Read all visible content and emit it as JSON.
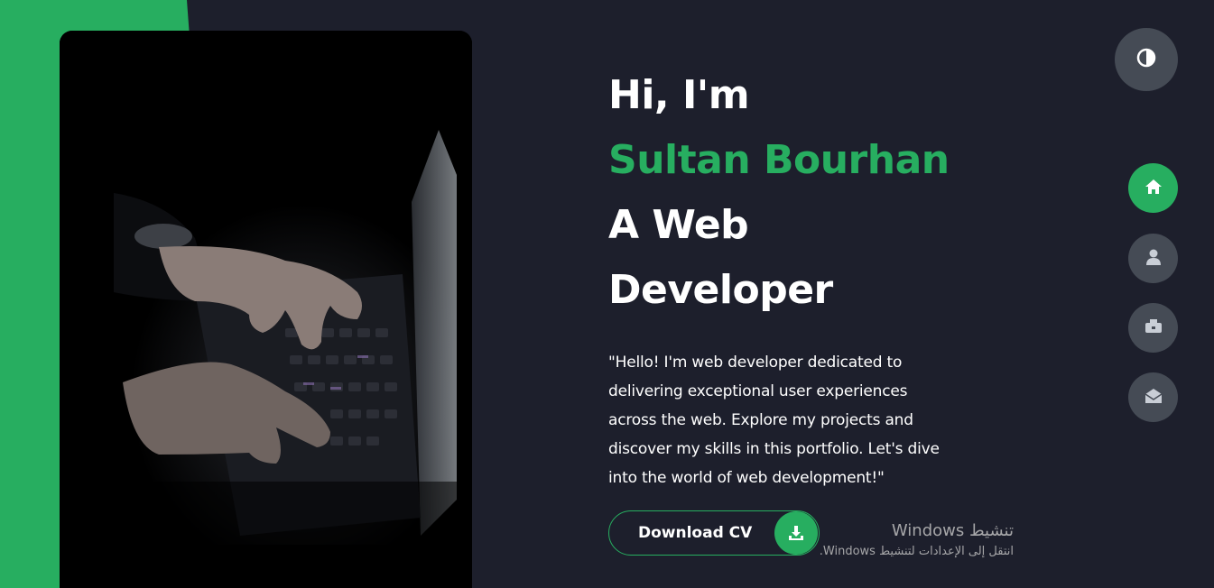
{
  "hero": {
    "greeting": "Hi, I'm",
    "name": "Sultan Bourhan",
    "role_line1": "A Web",
    "role_line2": "Developer",
    "intro": "\"Hello! I'm web developer dedicated to delivering exceptional user experiences across the web. Explore my projects and discover my skills in this portfolio. Let's dive into the world of web development!\"",
    "download_label": "Download CV"
  },
  "watermark": {
    "line1": "تنشيط Windows",
    "line2": "انتقل إلى الإعدادات لتنشيط Windows."
  },
  "nav": {
    "items": [
      {
        "icon": "home-icon",
        "active": true
      },
      {
        "icon": "user-icon",
        "active": false
      },
      {
        "icon": "briefcase-icon",
        "active": false
      },
      {
        "icon": "envelope-open-icon",
        "active": false
      }
    ]
  },
  "colors": {
    "accent": "#27ae60",
    "background": "#1d1f2c",
    "button_gray": "#454b55"
  }
}
